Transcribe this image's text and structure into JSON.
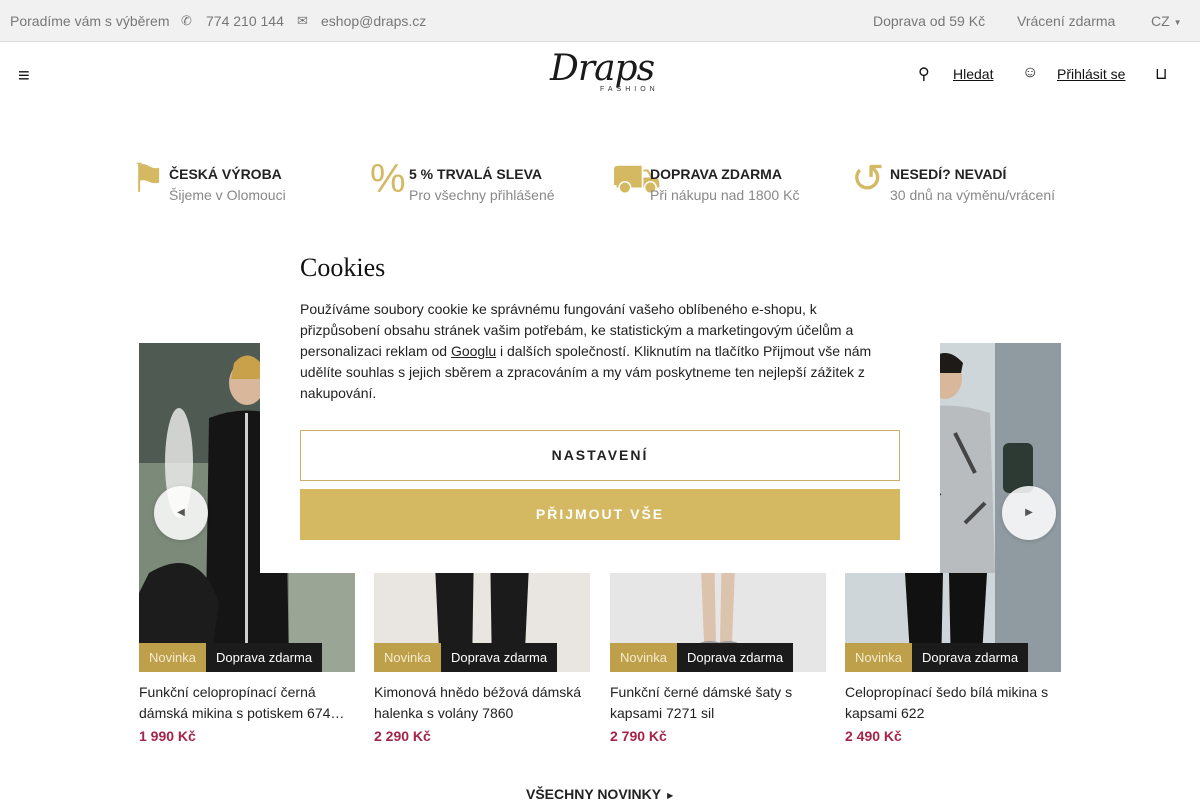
{
  "topbar": {
    "advice": "Poradíme vám s výběrem",
    "phone": "774 210 144",
    "email": "eshop@draps.cz",
    "shipping": "Doprava od 59 Kč",
    "returns": "Vrácení zdarma",
    "language": "CZ"
  },
  "header": {
    "logo_text": "Draps",
    "logo_tagline": "FASHION",
    "search_label": "Hledat",
    "login_label": "Přihlásit se",
    "menu_icon": "hamburger-icon",
    "search_icon": "search-icon",
    "user_icon": "user-icon",
    "cart_icon": "cart-icon"
  },
  "benefits": [
    {
      "title": "ČESKÁ VÝROBA",
      "subtitle": "Šijeme v Olomouci",
      "icon": "flag-icon"
    },
    {
      "title": "5 % TRVALÁ SLEVA",
      "subtitle": "Pro všechny přihlášené",
      "icon": "discount-icon"
    },
    {
      "title": "DOPRAVA ZDARMA",
      "subtitle": "Při nákupu nad 1800 Kč",
      "icon": "truck-icon"
    },
    {
      "title": "NESEDÍ? NEVADÍ",
      "subtitle": "30 dnů na výměnu/vrácení",
      "icon": "return-icon"
    }
  ],
  "products": [
    {
      "badge_new": "Novinka",
      "badge_shipping": "Doprava zdarma",
      "name": "Funkční celopropínací černá dámská mikina s potiskem 674…",
      "price": "1 990 Kč"
    },
    {
      "badge_new": "Novinka",
      "badge_shipping": "Doprava zdarma",
      "name": "Kimonová hnědo béžová dámská halenka s volány 7860",
      "price": "2 290 Kč"
    },
    {
      "badge_new": "Novinka",
      "badge_shipping": "Doprava zdarma",
      "name": "Funkční černé dámské šaty s kapsami 7271 sil",
      "price": "2 790 Kč"
    },
    {
      "badge_new": "Novinka",
      "badge_shipping": "Doprava zdarma",
      "name": "Celopropínací šedo bílá mikina s kapsami 622",
      "price": "2 490 Kč"
    }
  ],
  "all_new_link": "VŠECHNY NOVINKY",
  "cookies": {
    "title": "Cookies",
    "text_before_link": "Používáme soubory cookie ke správnému fungování vašeho oblíbeného e-shopu, k přizpůsobení obsahu stránek vašim potřebám, ke statistickým a marketingovým účelům a personalizaci reklam od ",
    "link_text": "Googlu",
    "text_after_link": " i dalších společností. Kliknutím na tlačítko Přijmout vše nám udělíte souhlas s jejich sběrem a zpracováním a my vám poskytneme ten nejlepší zážitek z nakupování.",
    "settings_button": "NASTAVENÍ",
    "accept_button": "PŘIJMOUT VŠE"
  },
  "colors": {
    "accent_gold": "#d4b862",
    "price_red": "#a6234a",
    "badge_dark": "#1b1b1b"
  }
}
